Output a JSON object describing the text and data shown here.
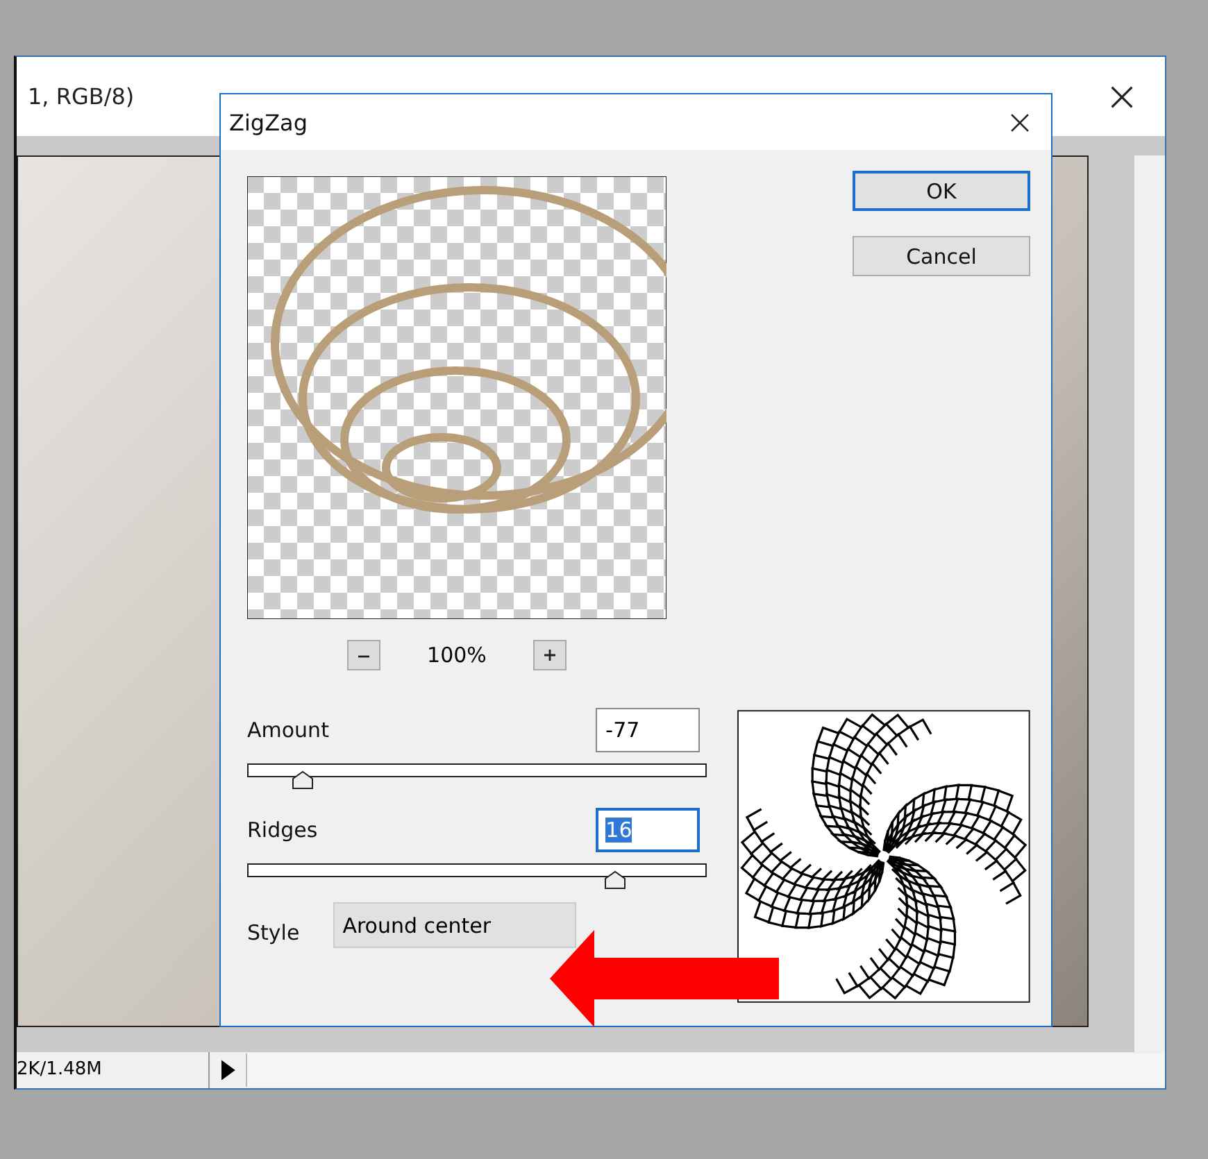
{
  "document_window": {
    "title": "1, RGB/8)",
    "status": "2K/1.48M"
  },
  "dialog": {
    "title": "ZigZag",
    "zoom": "100%",
    "buttons": [
      {
        "label": "OK",
        "default": true
      },
      {
        "label": "Cancel",
        "default": false
      }
    ],
    "controls": [
      {
        "label": "Amount",
        "value": "-77",
        "level": 0.12,
        "text_selected": false
      },
      {
        "label": "Ridges",
        "value": "16",
        "level": 0.8,
        "text_selected": true
      }
    ],
    "style": {
      "label": "Style",
      "value": "Around center"
    }
  },
  "annotation_arrow": true
}
